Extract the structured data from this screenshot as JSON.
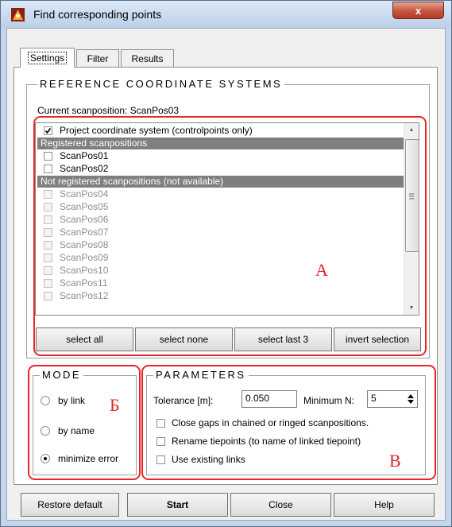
{
  "window": {
    "title": "Find corresponding points",
    "close_symbol": "x"
  },
  "tabs": [
    {
      "label": "Settings",
      "selected": true
    },
    {
      "label": "Filter",
      "selected": false
    },
    {
      "label": "Results",
      "selected": false
    }
  ],
  "ref_group": {
    "legend": "REFERENCE COORDINATE SYSTEMS",
    "current_scanposition": "Current scanposition: ScanPos03",
    "list": {
      "project_item": {
        "label": "Project coordinate system (controlpoints only)",
        "checked": true
      },
      "registered_header": "Registered scanpositions",
      "registered": [
        {
          "label": "ScanPos01",
          "checked": false
        },
        {
          "label": "ScanPos02",
          "checked": false
        }
      ],
      "not_registered_header": "Not registered scanpositions (not available)",
      "not_registered": [
        "ScanPos04",
        "ScanPos05",
        "ScanPos06",
        "ScanPos07",
        "ScanPos08",
        "ScanPos09",
        "ScanPos10",
        "ScanPos11",
        "ScanPos12"
      ]
    },
    "buttons": {
      "select_all": "select all",
      "select_none": "select none",
      "select_last_3": "select last 3",
      "invert_selection": "invert selection"
    }
  },
  "mode_group": {
    "legend": "MODE",
    "options": [
      {
        "label": "by link",
        "selected": false
      },
      {
        "label": "by name",
        "selected": false
      },
      {
        "label": "minimize error",
        "selected": true
      }
    ]
  },
  "params_group": {
    "legend": "PARAMETERS",
    "tolerance_label": "Tolerance [m]:",
    "tolerance_value": "0.050",
    "minimum_n_label": "Minimum N:",
    "minimum_n_value": "5",
    "checkboxes": [
      {
        "label": "Close gaps in chained or ringed scanpositions.",
        "checked": false
      },
      {
        "label": "Rename tiepoints (to name of linked tiepoint)",
        "checked": false
      },
      {
        "label": "Use existing links",
        "checked": false
      }
    ]
  },
  "annotations": {
    "a": "A",
    "b": "Б",
    "c": "B",
    "color": "#e8262a"
  },
  "footer": {
    "restore_default": "Restore default",
    "start": "Start",
    "close": "Close",
    "help": "Help"
  }
}
